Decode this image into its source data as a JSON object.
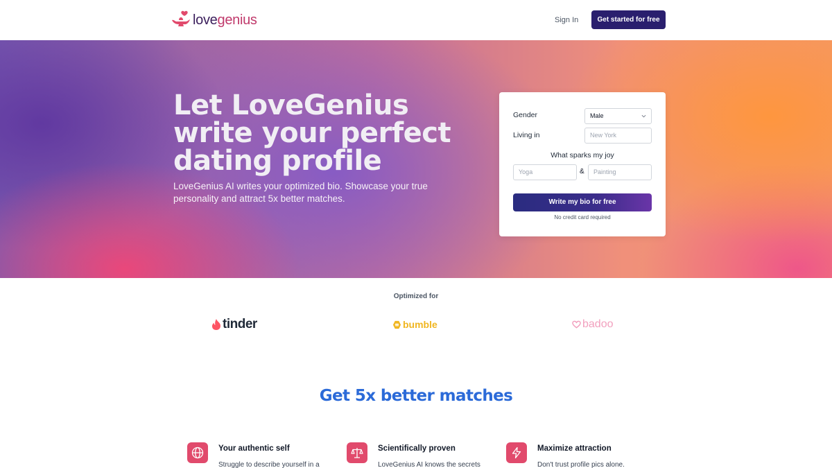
{
  "header": {
    "logo_love": "love",
    "logo_genius": "genius",
    "signin_label": "Sign In",
    "cta_label": "Get started for free"
  },
  "hero": {
    "title": "Let LoveGenius write your perfect dating profile",
    "subtitle": "LoveGenius AI writes your optimized bio. Showcase your true personality and attract 5x better matches."
  },
  "form": {
    "gender_label": "Gender",
    "gender_value": "Male",
    "living_label": "Living in",
    "living_placeholder": "New York",
    "joy_label": "What sparks my joy",
    "joy1_placeholder": "Yoga",
    "amp": "&",
    "joy2_placeholder": "Painting",
    "submit_label": "Write my bio for free",
    "note": "No credit card required"
  },
  "optimized": {
    "label": "Optimized for",
    "brands": [
      "tinder",
      "bumble",
      "badoo"
    ]
  },
  "section": {
    "title": "Get 5x better matches"
  },
  "features": [
    {
      "icon": "globe-icon",
      "title": "Your authentic self",
      "text": "Struggle to describe yourself in a"
    },
    {
      "icon": "scale-icon",
      "title": "Scientifically proven",
      "text": "LoveGenius AI knows the secrets"
    },
    {
      "icon": "lightning-icon",
      "title": "Maximize attraction",
      "text": "Don't trust profile pics alone."
    }
  ],
  "colors": {
    "primary": "#2a1f6e",
    "accent": "#e14a6c",
    "heading_blue": "#2b6ad8",
    "bumble": "#f0b620",
    "badoo": "#f2a0be",
    "tinder_flame": "#fd5564"
  }
}
